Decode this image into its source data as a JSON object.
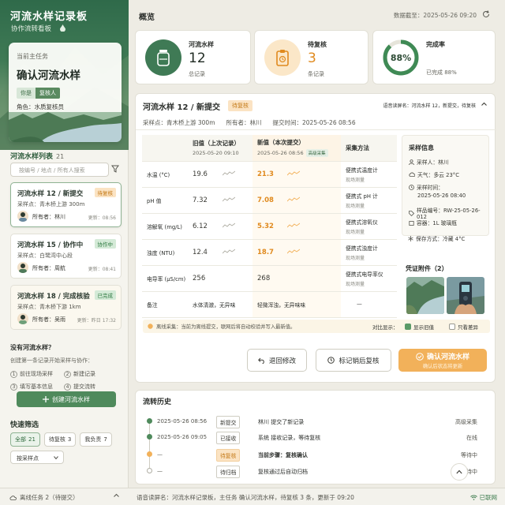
{
  "app": {
    "title": "河流水样记录板",
    "subtitle": "协作流转看板"
  },
  "current_task": {
    "label": "当前主任务",
    "title": "确认河流水样",
    "chip_left": "你是",
    "chip_right": "复核人",
    "role": "角色：水质复核员"
  },
  "list": {
    "title": "河流水样列表",
    "count": "21",
    "search_placeholder": "按编号 / 地点 / 所有人搜索",
    "records": [
      {
        "title": "河流水样 12 / 新提交",
        "badge": "待复核",
        "loc": "采样点：青木桥上游 300m",
        "owner": "所有者：林川",
        "time": "更新：08:56"
      },
      {
        "title": "河流水样 15 / 协作中",
        "badge": "协作中",
        "loc": "采样点：白鹭湾中心段",
        "owner": "所有者：周航",
        "time": "更新：08:41"
      },
      {
        "title": "河流水样 18 / 完成核验",
        "badge": "已完成",
        "loc": "采样点：青木桥下游 1km",
        "owner": "所有者：吴雨",
        "time": "更新：昨日 17:32"
      }
    ]
  },
  "empty": {
    "title": "没有河流水样？",
    "sub": "创建第一条记录开始采样与协作：",
    "steps": [
      "1 前往现场采样",
      "2 新建记录",
      "3 填写基本信息",
      "4 提交流转"
    ],
    "step_nums": [
      "1",
      "2",
      "3",
      "4"
    ],
    "step_labels": [
      "前往现场采样",
      "新建记录",
      "填写基本信息",
      "提交流转"
    ],
    "create_label": "创建河流水样"
  },
  "quick": {
    "title": "快速筛选",
    "pills": [
      {
        "label": "全部",
        "n": "21"
      },
      {
        "label": "待复核",
        "n": "3"
      },
      {
        "label": "我负责",
        "n": "7"
      }
    ],
    "select": "按采样点"
  },
  "footer": {
    "offline": "离线任务 2（待提交）",
    "voice": "语音读屏名：河流水样记录板，主任务 确认河流水样，待复核 3 条，更新于 09:20",
    "net": "已联网"
  },
  "main": {
    "title": "概览",
    "sync": "数据截至：2025-05-26 09:20"
  },
  "stats": [
    {
      "label": "河流水样",
      "num": "12",
      "sub": "总记录"
    },
    {
      "label": "待复核",
      "num": "3",
      "sub": "条记录"
    },
    {
      "label": "完成率",
      "num": "88%",
      "sub": "已完成 88%",
      "percent": 88
    }
  ],
  "detail": {
    "title": "河流水样 12 / 新提交",
    "badge": "待复核",
    "voice": "语音读屏名：河流水样 12，新提交，待复核",
    "meta": [
      "采样点：青木桥上游 300m",
      "所有者：林川",
      "提交时间：2025-05-26 08:56"
    ],
    "table": {
      "col_old": "旧值（上次记录）",
      "col_old_sub": "2025-05-20 09:10",
      "col_new": "新值（本次提交）",
      "col_new_sub": "2025-05-26 08:56",
      "col_new_chip": "高级采集",
      "col_method": "采集方法",
      "rows": [
        {
          "param": "水温 (°C)",
          "old": "19.6",
          "new": "21.3",
          "method": "便携式温度计",
          "sub": "现场测量"
        },
        {
          "param": "pH 值",
          "old": "7.32",
          "new": "7.08",
          "method": "便携式 pH 计",
          "sub": "现场测量"
        },
        {
          "param": "溶解氧 (mg/L)",
          "old": "6.12",
          "new": "5.32",
          "method": "便携式溶氧仪",
          "sub": "现场测量"
        },
        {
          "param": "浊度 (NTU)",
          "old": "12.4",
          "new": "18.7",
          "method": "便携式浊度计",
          "sub": "现场测量"
        },
        {
          "param": "电导率 (μS/cm)",
          "old": "256",
          "new": "268",
          "method": "便携式电导率仪",
          "sub": "现场测量"
        }
      ],
      "note": {
        "param": "备注",
        "old": "水体清澈，无异味",
        "new": "轻微浑浊，无异味味",
        "method": "—"
      }
    },
    "info": {
      "title": "采样信息",
      "rows": [
        "采样人：林川",
        "天气：多云 23°C",
        "采样时间：",
        "2025-05-26 08:40",
        "样品编号：RW-25-05-26-012",
        "容器：1L 玻璃瓶",
        "保存方式：冷藏 4°C"
      ]
    },
    "attach_title": "凭证附件（2）",
    "offline_note": "离线采集：当前为离线提交，联网后将自动校验并写入最新值。",
    "compare": {
      "label": "对比显示：",
      "opt1": "显示旧值",
      "opt2": "只看差异"
    },
    "buttons": {
      "back": "退回修改",
      "mark": "标记销后复核",
      "confirm": "确认河流水样",
      "confirm_sub": "确认后状态将更新"
    }
  },
  "history": {
    "title": "流转历史",
    "rows": [
      {
        "time": "2025-05-26 08:56",
        "tag": "新提交",
        "desc": "林川 提交了新记录",
        "res": "高级采集"
      },
      {
        "time": "2025-05-26 09:05",
        "tag": "已接收",
        "desc": "系统 接收记录，等待复核",
        "res": "在线"
      },
      {
        "time": "—",
        "tag": "待复核",
        "desc": "当前步骤：复核确认",
        "res": "等待中"
      },
      {
        "time": "—",
        "tag": "待归档",
        "desc": "复核通过后自动归档",
        "res": "等待中"
      }
    ]
  },
  "colors": {
    "brand": "#3f7a55",
    "accent": "#f2b15a",
    "warning": "#e08a1e",
    "success": "#4f8a5c"
  },
  "icons": [
    "water-drop-icon",
    "filter-icon",
    "plus-icon",
    "refresh-icon",
    "jar-icon",
    "clipboard-icon",
    "chevron-up-icon",
    "undo-icon",
    "clock-icon",
    "check-icon",
    "user-icon",
    "cloud-icon",
    "tag-icon",
    "box-icon",
    "snow-icon",
    "wifi-icon"
  ]
}
